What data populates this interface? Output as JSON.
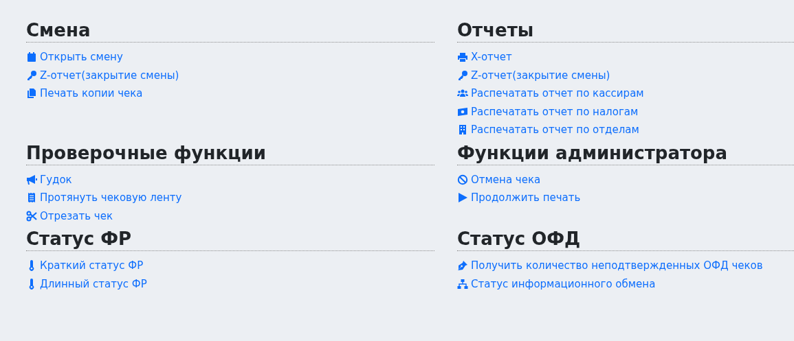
{
  "sections": [
    {
      "title": "Смена",
      "items": [
        {
          "label": "Открыть смену",
          "kind": "calendar"
        },
        {
          "label": "Z-отчет(закрытие смены)",
          "kind": "key"
        },
        {
          "label": "Печать копии чека",
          "kind": "copy"
        }
      ]
    },
    {
      "title": "Отчеты",
      "items": [
        {
          "label": "X-отчет",
          "kind": "printer"
        },
        {
          "label": "Z-отчет(закрытие смены)",
          "kind": "key"
        },
        {
          "label": "Распечатать отчет по кассирам",
          "kind": "users"
        },
        {
          "label": "Распечатать отчет по налогам",
          "kind": "money"
        },
        {
          "label": "Распечатать отчет по отделам",
          "kind": "building"
        }
      ]
    },
    {
      "title": "Проверочные функции",
      "items": [
        {
          "label": "Гудок",
          "kind": "megaphone"
        },
        {
          "label": "Протянуть чековую ленту",
          "kind": "receipt"
        },
        {
          "label": "Отрезать чек",
          "kind": "scissors"
        }
      ]
    },
    {
      "title": "Функции администратора",
      "items": [
        {
          "label": "Отмена чека",
          "kind": "ban"
        },
        {
          "label": "Продолжить печать",
          "kind": "play"
        }
      ]
    },
    {
      "title": "Статус ФР",
      "items": [
        {
          "label": "Краткий статус ФР",
          "kind": "thermometer"
        },
        {
          "label": "Длинный статус ФР",
          "kind": "thermometer"
        }
      ]
    },
    {
      "title": "Статус ОФД",
      "items": [
        {
          "label": "Получить количество неподтвержденных ОФД чеков",
          "kind": "pen"
        },
        {
          "label": "Статус информационного обмена",
          "kind": "network"
        }
      ]
    }
  ]
}
